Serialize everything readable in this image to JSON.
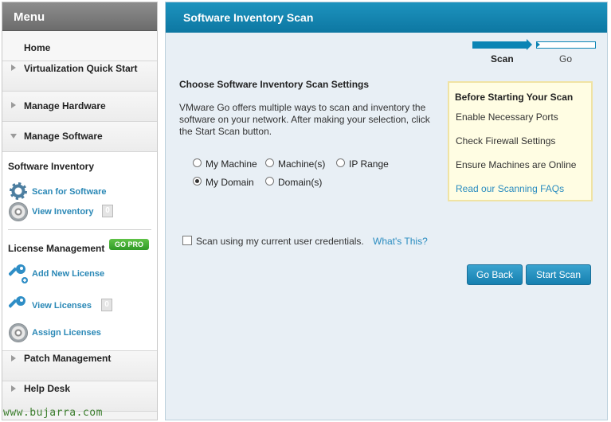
{
  "sidebar": {
    "title": "Menu",
    "home": "Home",
    "virtualization": "Virtualization Quick Start",
    "hardware": "Manage Hardware",
    "software": "Manage Software",
    "software_inventory": {
      "heading": "Software Inventory",
      "scan": "Scan for Software",
      "view": "View Inventory",
      "view_count": "0"
    },
    "license_management": {
      "heading": "License Management",
      "badge": "GO PRO",
      "add": "Add New License",
      "view": "View Licenses",
      "view_count": "0",
      "assign": "Assign Licenses"
    },
    "patch": "Patch Management",
    "helpdesk": "Help Desk"
  },
  "watermark": "www.bujarra.com",
  "panel": {
    "title": "Software Inventory Scan",
    "steps": [
      "Scan",
      "Go"
    ],
    "section_title": "Choose Software Inventory Scan Settings",
    "intro": "VMware Go offers multiple ways to scan and inventory the software on your network. After making your selection, click the Start Scan button.",
    "options": {
      "my_machine": "My Machine",
      "machines": "Machine(s)",
      "ip_range": "IP Range",
      "my_domain": "My Domain",
      "domains": "Domain(s)",
      "selected": "My Domain"
    },
    "credentials_label": "Scan using my current user credentials.",
    "whats_this": "What's This?",
    "back_button": "Go Back",
    "start_button": "Start Scan"
  },
  "tips": {
    "title": "Before Starting Your Scan",
    "items": [
      "Enable Necessary Ports",
      "Check Firewall Settings",
      "Ensure Machines are Online"
    ],
    "link": "Read our Scanning FAQs"
  },
  "colors": {
    "header_blue": "#0d77a2",
    "link_blue": "#2a88b6",
    "gopro_green": "#2f9a26"
  }
}
